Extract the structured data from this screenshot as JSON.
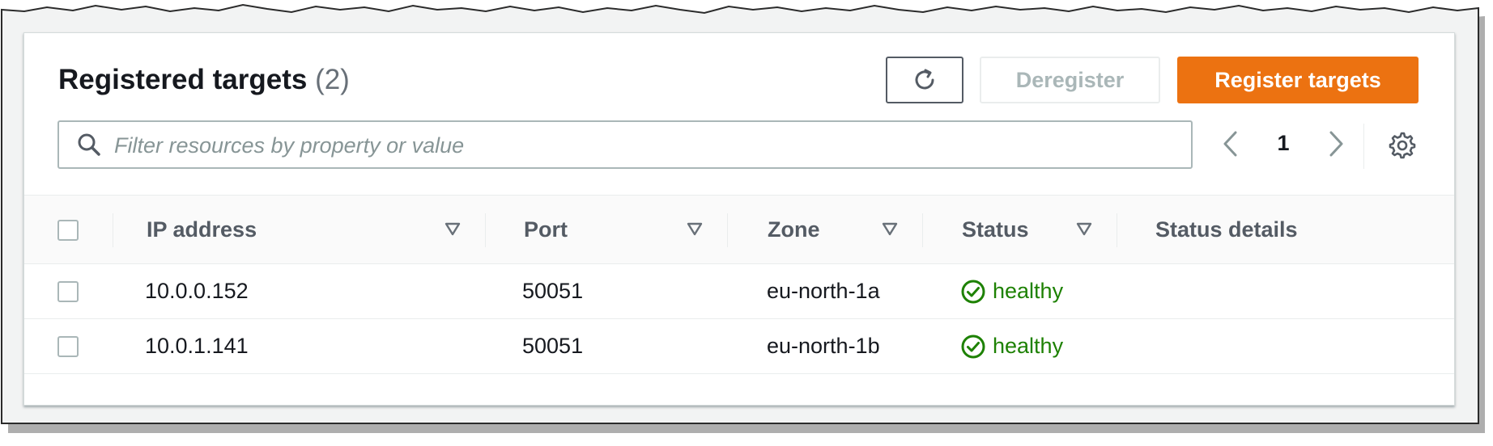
{
  "header": {
    "title": "Registered targets",
    "count": "(2)",
    "deregister_label": "Deregister",
    "register_label": "Register targets"
  },
  "search": {
    "placeholder": "Filter resources by property or value"
  },
  "pagination": {
    "current_page": "1"
  },
  "table": {
    "columns": [
      "IP address",
      "Port",
      "Zone",
      "Status",
      "Status details"
    ],
    "rows": [
      {
        "ip": "10.0.0.152",
        "port": "50051",
        "zone": "eu-north-1a",
        "status": "healthy",
        "details": ""
      },
      {
        "ip": "10.0.1.141",
        "port": "50051",
        "zone": "eu-north-1b",
        "status": "healthy",
        "details": ""
      }
    ]
  },
  "colors": {
    "accent": "#ec7211",
    "healthy": "#1d8102",
    "disabled_text": "#aab7b8"
  },
  "icons": {
    "refresh": "refresh-icon",
    "search": "search-icon",
    "prev": "chevron-left-icon",
    "next": "chevron-right-icon",
    "settings": "gear-icon",
    "sort": "sort-triangle-icon",
    "status": "check-circle-icon"
  }
}
